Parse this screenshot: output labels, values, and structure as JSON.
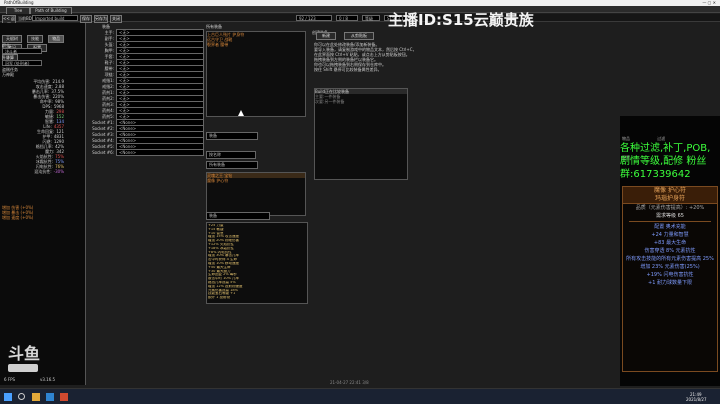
{
  "window": {
    "title": "PathOfBuilding"
  },
  "top_tabs": [
    "Tree",
    "Path of Building"
  ],
  "toolbar": {
    "back": "<< 返回",
    "title_label": "当前BD",
    "build_name": "Imported build",
    "save": "保存",
    "save_as": "另存为",
    "close": "关闭"
  },
  "tree_info": {
    "level": "92 / 123",
    "points": "0 / 8",
    "mode": "等级",
    "version": "S15 (3.17)"
  },
  "streamer_banner": "主播ID:S15云巅贵族",
  "left_tabs": [
    "天赋树",
    "技能",
    "物品",
    "计算",
    "笔记",
    "配置"
  ],
  "left_sections": {
    "class_label": "职业:",
    "class": "决斗者",
    "ascend_label": "升华:",
    "ascend": "冠军 (处刑者)",
    "bandit": "盗贼任务",
    "pantheon": "万神殿"
  },
  "left_stats": [
    {
      "k": "平均伤害:",
      "v": "214.9"
    },
    {
      "k": "攻击速度:",
      "v": "2.88"
    },
    {
      "k": "暴击几率:",
      "v": "37.5%"
    },
    {
      "k": "暴击伤害:",
      "v": "220%"
    },
    {
      "k": "命中率:",
      "v": "98%"
    },
    {
      "k": "DPS:",
      "v": "5968"
    },
    {
      "k": "力量:",
      "v": "298"
    },
    {
      "k": "敏捷:",
      "v": "152"
    },
    {
      "k": "智慧:",
      "v": "134"
    },
    {
      "k": "Life:",
      "v": "4357"
    },
    {
      "k": "生命回复:",
      "v": "121"
    },
    {
      "k": "护甲:",
      "v": "4831"
    },
    {
      "k": "闪避:",
      "v": "1290"
    },
    {
      "k": "格挡几率:",
      "v": "42%"
    },
    {
      "k": "魔力:",
      "v": "342"
    },
    {
      "k": "火焰抗性:",
      "v": "75%"
    },
    {
      "k": "冰霜抗性:",
      "v": "75%"
    },
    {
      "k": "闪电抗性:",
      "v": "76%"
    },
    {
      "k": "混沌抗性:",
      "v": "-30%"
    }
  ],
  "left_extras": [
    "增加 伤害 (+0%)",
    "增加 暴击 (+0%)",
    "增加 速度 (+0%)"
  ],
  "equipment": {
    "header": "装备",
    "slots": [
      {
        "slot": "主手:",
        "item": "<无>"
      },
      {
        "slot": "副手:",
        "item": "<无>"
      },
      {
        "slot": "头盔:",
        "item": "<无>"
      },
      {
        "slot": "胸甲:",
        "item": "<无>"
      },
      {
        "slot": "手套:",
        "item": "<无>"
      },
      {
        "slot": "鞋子:",
        "item": "<无>"
      },
      {
        "slot": "腰带:",
        "item": "<无>"
      },
      {
        "slot": "项链:",
        "item": "<无>"
      },
      {
        "slot": "戒指1:",
        "item": "<无>"
      },
      {
        "slot": "戒指2:",
        "item": "<无>"
      },
      {
        "slot": "药剂1:",
        "item": "<无>"
      },
      {
        "slot": "药剂2:",
        "item": "<无>"
      },
      {
        "slot": "药剂3:",
        "item": "<无>"
      },
      {
        "slot": "药剂4:",
        "item": "<无>"
      },
      {
        "slot": "药剂5:",
        "item": "<无>"
      },
      {
        "slot": "Socket #1:",
        "item": "<None>"
      },
      {
        "slot": "Socket #2:",
        "item": "<None>"
      },
      {
        "slot": "Socket #3:",
        "item": "<None>"
      },
      {
        "slot": "Socket #4:",
        "item": "<None>"
      },
      {
        "slot": "Socket #5:",
        "item": "<None>"
      },
      {
        "slot": "Socket #6:",
        "item": "<None>"
      }
    ]
  },
  "all_items": {
    "header": "所有装备",
    "buttons": [
      "新增",
      "导入",
      "删除未使用"
    ],
    "list": [
      "上古巨人残片 护身符",
      "远古守卫 战靴",
      "裂界者 腰带"
    ]
  },
  "item_filter": {
    "label1": "装备",
    "label2": "所有装备",
    "sort": "按名称"
  },
  "selected_item_list": [
    "灵魂之王 宝钻",
    "魔像 护心符"
  ],
  "craft": {
    "header": "创建装备",
    "new": "新建",
    "from_clip": "从剪贴板"
  },
  "help_lines": [
    "你可以在此处修改装备/添加新装备。",
    "要导入装备，请复制游戏中的物品文本，然后按 Ctrl+C，",
    "在此界面按 Ctrl+V 粘贴，或点击上方从剪贴板按钮。",
    "拖拽装备到左侧的装备栏以装备它。",
    "你也可以拖拽装备到右侧保存到仓库中。",
    "按住 Shift 悬停可比较装备属性差异。"
  ],
  "build_panel": {
    "header": "Build正在比较装备",
    "lines": [
      "主要:一件装备",
      "次要:另一件装备"
    ]
  },
  "mods_panel": {
    "header": "装备",
    "mods": [
      "+25 力量",
      "+15 敏捷",
      "+10 智慧",
      "增加 15% 攻击速度",
      "增加 20% 物理伤害",
      "+12% 火焰抗性",
      "+18% 冰霜抗性",
      "+8% 闪电抗性",
      "增加 30% 暴击几率",
      "击中时获得 4 生命",
      "增加 10% 移动速度",
      "+50 最大生命",
      "+30 最大魔力",
      "生命回复 2% 每秒",
      "被击中时 10% 几率",
      "格挡几率提高 5%",
      "增加 12% 投射物速度",
      "元素伤害提高 18%",
      "技能宝石等级 +1",
      "额外 1 投射物"
    ]
  },
  "promo": {
    "lines": [
      "各种过滤,补丁,POB,",
      "剧情等级,配修 粉丝",
      "群:617339642"
    ],
    "colors": {
      "text": "#3cff3c"
    }
  },
  "item_card": {
    "title": "魔像 护心符",
    "subtitle": "玛瑙护身符",
    "quality": "品质（元素伤害提高）: +20%",
    "req": "需求等级 65",
    "mods": [
      "配置 奥术充能",
      "+24 力量和智慧",
      "+83 最大生命",
      "伤害穿透 8% 元素抗性",
      "所有攻击技能的所有元素伤害提高 25%",
      "增加 23% 元素伤害(25%)",
      "+19% 闪电伤害抗性",
      "+1 耐力球数量下限"
    ],
    "colors": {
      "unique": "#af6025",
      "border": "#7a4a20",
      "mod": "#7f9cff"
    }
  },
  "side_tabs": [
    "物品",
    "过滤",
    "配置"
  ],
  "taskbar": {
    "time": "21:49",
    "date": "2021/8/27",
    "bottom_center": "21-04-27 22:41 3/8"
  },
  "bottom_left": {
    "fps": "6 FPS",
    "ver": "v3.16.5"
  },
  "logo": "斗鱼",
  "accent": "#d9883a"
}
